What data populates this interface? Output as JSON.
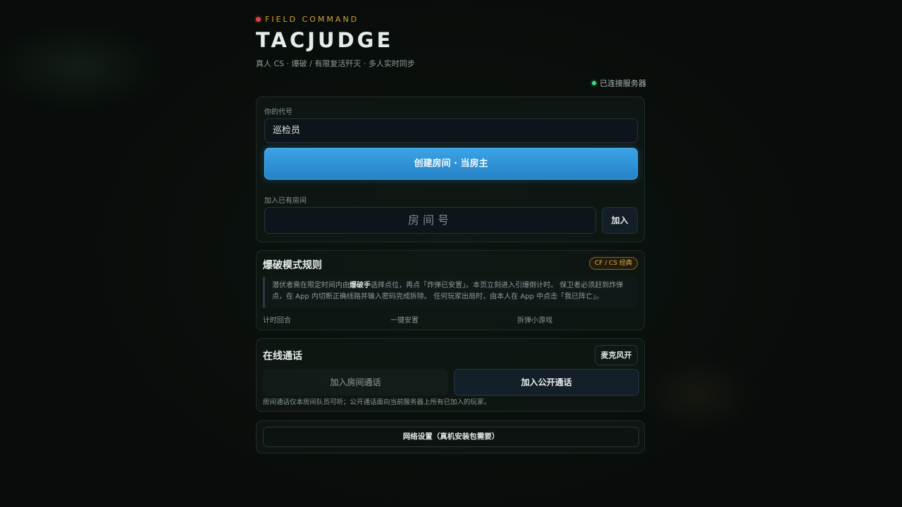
{
  "header": {
    "kicker": "FIELD COMMAND",
    "title": "TACJUDGE",
    "subtitle": "真人 CS · 爆破 / 有限复活歼灭 · 多人实时同步",
    "connection_status": "已连接服务器",
    "colors": {
      "kicker_dot": "#e0463e",
      "kicker_text": "#d9a23a",
      "status_dot": "#3ddc84"
    }
  },
  "lobby": {
    "name_label": "你的代号",
    "name_value": "巡检员",
    "create_button": "创建房间 · 当房主",
    "join_label": "加入已有房间",
    "room_placeholder": "房间号",
    "join_button": "加入",
    "accent_color": "#3aa3e6"
  },
  "rules": {
    "title": "爆破模式规则",
    "badge": "CF / CS 经典",
    "text_before": "潜伏者需在限定时间内由",
    "text_bold": "爆破手",
    "text_after": "选择点位，再点「炸弹已安置」。本页立刻进入引爆倒计时。 保卫者必须赶到炸弹点，在 App 内切断正确线路并输入密码完成拆除。 任何玩家出局时，由本人在 App 中点击「我已阵亡」。",
    "features": [
      "计时回合",
      "一键安置",
      "拆弹小游戏"
    ]
  },
  "voice": {
    "title": "在线通话",
    "mic_button": "麦克风开",
    "room_call_button": "加入房间通话",
    "public_call_button": "加入公开通话",
    "note": "房间通话仅本房间队员可听；公开通话面向当前服务器上所有已加入的玩家。"
  },
  "network": {
    "button": "网络设置（真机安装包需要）"
  }
}
